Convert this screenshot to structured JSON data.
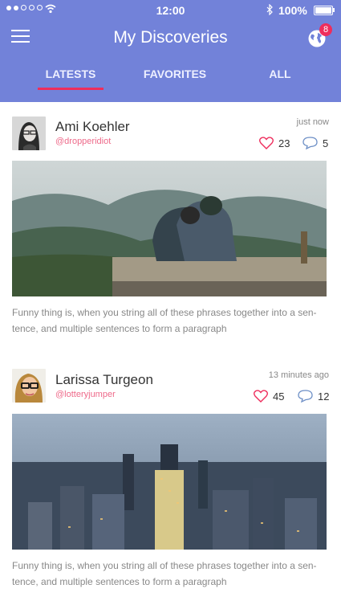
{
  "status": {
    "time": "12:00",
    "battery": "100%"
  },
  "header": {
    "title": "My Discoveries",
    "notifications": "8"
  },
  "tabs": [
    {
      "label": "LATESTS"
    },
    {
      "label": "FAVORITES"
    },
    {
      "label": "ALL"
    }
  ],
  "posts": [
    {
      "name": "Ami Koehler",
      "handle": "@dropperidiot",
      "time": "just now",
      "likes": "23",
      "comments": "5",
      "caption": "Funny thing is, when you string all of these phrases together into a sen-tence, and multiple sentences to form a paragraph"
    },
    {
      "name": "Larissa Turgeon",
      "handle": "@lotteryjumper",
      "time": "13 minutes ago",
      "likes": "45",
      "comments": "12",
      "caption": "Funny thing is, when you string all of these phrases together into a sen-tence, and multiple sentences to form a paragraph"
    }
  ],
  "colors": {
    "header": "#7282d9",
    "accent": "#ee2d5c"
  }
}
